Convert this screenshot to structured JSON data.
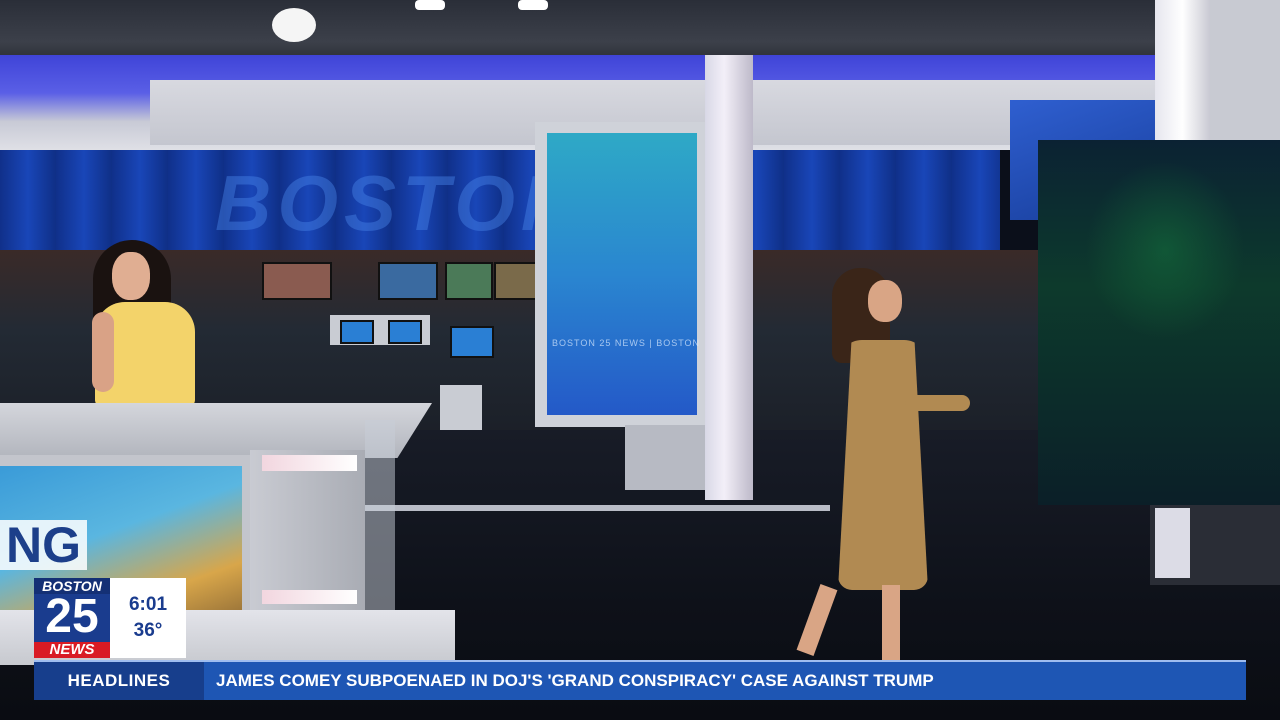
{
  "scene": {
    "wall_text": "BOSTON",
    "tower_caption": "BOSTON 25 NEWS  |  BOSTON",
    "desk_screen_text": "NG"
  },
  "bug": {
    "city": "BOSTON",
    "channel": "25",
    "brand": "NEWS",
    "time": "6:01",
    "temperature": "36°"
  },
  "ticker": {
    "label": "HEADLINES",
    "headline": "JAMES COMEY SUBPOENAED IN DOJ'S 'GRAND CONSPIRACY' CASE AGAINST TRUMP"
  },
  "colors": {
    "brand_blue": "#1a3c8e",
    "ticker_blue": "#1e56b4",
    "news_red": "#d91b24"
  }
}
